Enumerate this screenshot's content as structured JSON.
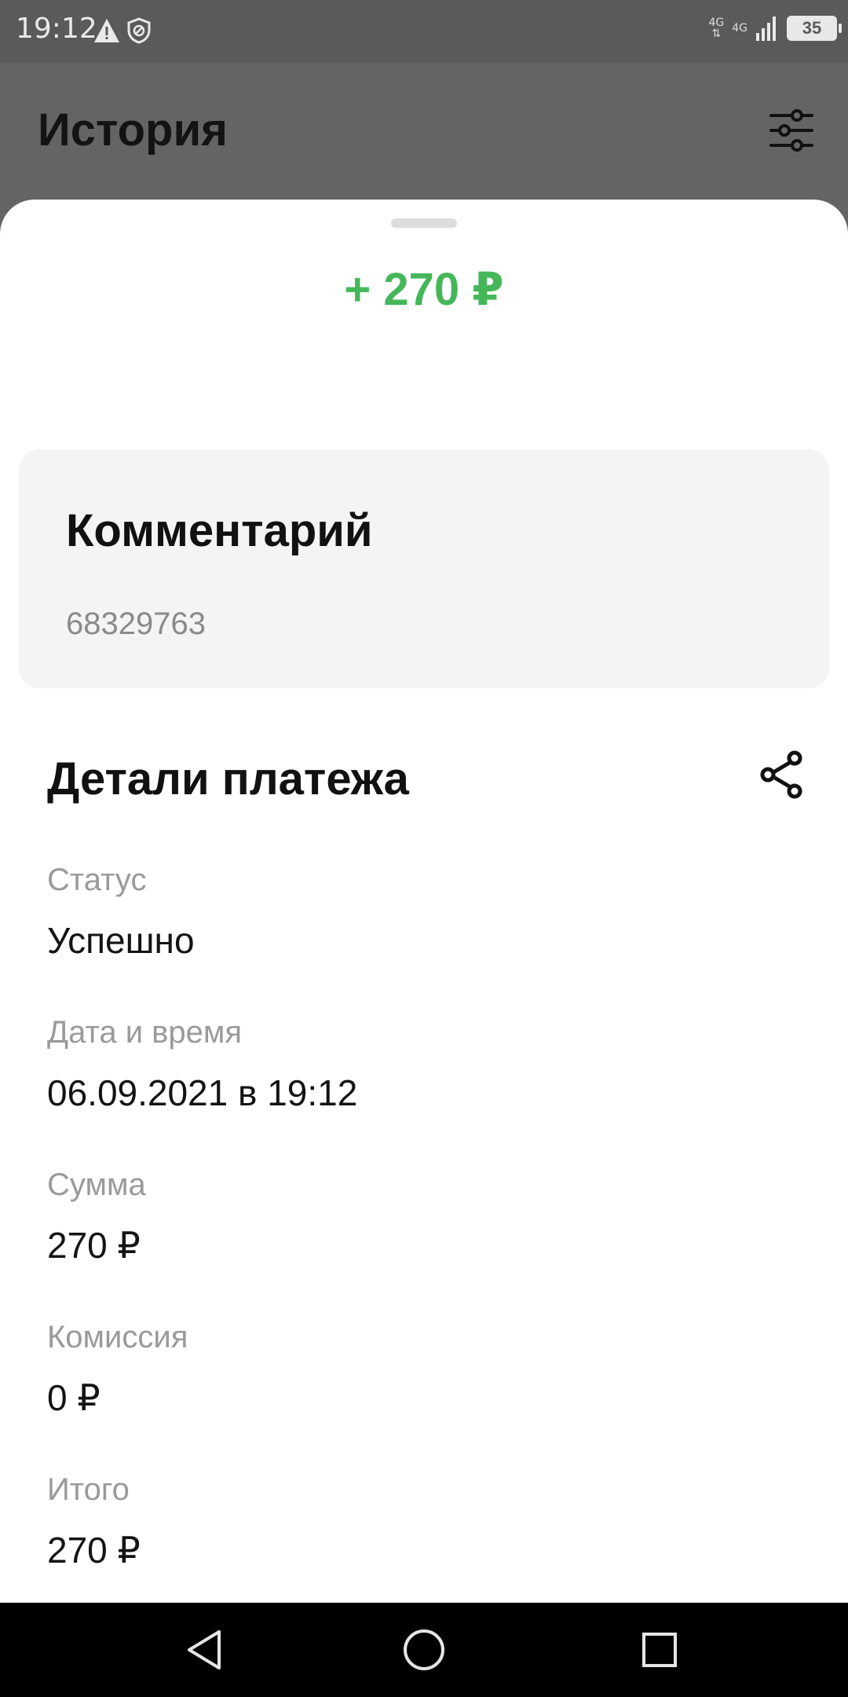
{
  "status_bar": {
    "time": "19:12",
    "network_1": "4G",
    "network_2": "4G",
    "battery": "35",
    "icons": [
      "warning-icon",
      "shield-icon",
      "signal-icon",
      "battery-icon"
    ]
  },
  "app_bar": {
    "title": "История",
    "filter_icon": "filter-sliders-icon"
  },
  "sheet": {
    "amount": "+ 270 ₽",
    "comment": {
      "title": "Комментарий",
      "text": "68329763"
    },
    "details": {
      "title": "Детали платежа",
      "share_icon": "share-icon",
      "rows": [
        {
          "label": "Статус",
          "value": "Успешно"
        },
        {
          "label": "Дата и время",
          "value": "06.09.2021 в 19:12"
        },
        {
          "label": "Сумма",
          "value": "270 ₽"
        },
        {
          "label": "Комиссия",
          "value": "0 ₽"
        },
        {
          "label": "Итого",
          "value": "270 ₽"
        }
      ]
    }
  },
  "colors": {
    "accent_green": "#45b75a",
    "overlay_gray": "#646464",
    "card_bg": "#f4f4f4"
  },
  "nav_bar": {
    "icons": [
      "back-icon",
      "home-icon",
      "recents-icon"
    ]
  }
}
